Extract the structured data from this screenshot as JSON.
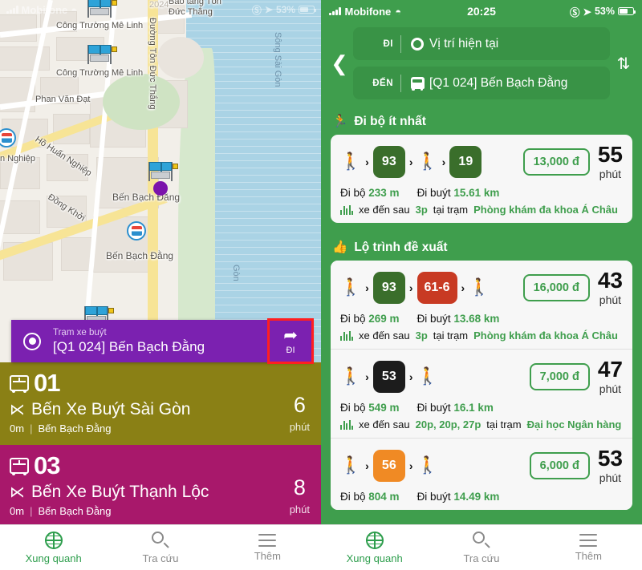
{
  "left_panel": {
    "status_bar": {
      "carrier": "Mobifone",
      "wifi_icon": "wifi-icon",
      "lock_icon": "rotation-lock-icon",
      "location_icon": "location-arrow-icon",
      "battery_text": "53%"
    },
    "map": {
      "labels": [
        "Công Trường Mê Linh",
        "Công Trường Mê Linh",
        "Bảo tàng Tôn Đức Thắng",
        "Phan Văn Đạt",
        "Hồ Huấn Nghiệp",
        "n Nghiệp",
        "Đồng Khởi",
        "Đường Tôn Đức Thắng",
        "Sông Sài Gòn",
        "Gòn",
        "Bến Bạch Đằng",
        "Bến Bạch Đằng",
        "2024"
      ]
    },
    "stop_card": {
      "kicker": "Trạm xe buýt",
      "title": "[Q1 024] Bến Bạch Đằng",
      "go_label": "ĐI",
      "go_icon": "share-arrow-icon",
      "target_icon": "crosshair-icon",
      "bg_color": "#7b21b0",
      "highlight_color": "#ff1f1f"
    },
    "routes": [
      {
        "number": "01",
        "destination": "Bến Xe Buýt Sài Gòn",
        "distance": "0m",
        "stop": "Bến Bạch Đằng",
        "minutes": "6",
        "unit": "phút",
        "color": "#8a8015"
      },
      {
        "number": "03",
        "destination": "Bến Xe Buýt Thạnh Lộc",
        "distance": "0m",
        "stop": "Bến Bạch Đằng",
        "minutes": "8",
        "unit": "phút",
        "color": "#a8186b"
      }
    ],
    "tabbar": [
      {
        "label": "Xung quanh",
        "icon": "globe-icon",
        "active": true
      },
      {
        "label": "Tra cứu",
        "icon": "search-icon",
        "active": false
      },
      {
        "label": "Thêm",
        "icon": "hamburger-icon",
        "active": false
      }
    ]
  },
  "right_panel": {
    "status_bar": {
      "carrier": "Mobifone",
      "wifi_icon": "wifi-icon",
      "time": "20:25",
      "battery_text": "53%"
    },
    "search": {
      "back_icon": "chevron-left-icon",
      "swap_icon": "swap-vertical-icon",
      "origin": {
        "kicker": "ĐI",
        "icon": "gps-icon",
        "value": "Vị trí hiện tại"
      },
      "destination": {
        "kicker": "ĐẾN",
        "icon": "bus-icon",
        "value": "[Q1 024] Bến Bạch Đằng"
      }
    },
    "sections": [
      {
        "icon": "walking-person-emoji",
        "title": "Đi bộ ít nhất",
        "options": [
          {
            "legs": [
              {
                "type": "walk"
              },
              {
                "type": "bus",
                "label": "93",
                "color": "#3a6e2b"
              },
              {
                "type": "walk"
              },
              {
                "type": "bus",
                "label": "19",
                "color": "#3a6e2b"
              }
            ],
            "fare": "13,000 đ",
            "duration": "55",
            "duration_unit": "phút",
            "walk_label": "Đi bộ",
            "walk_value": "233 m",
            "bus_label": "Đi buýt",
            "bus_value": "15.61 km",
            "arrival_prefix": "xe đến sau",
            "arrival_time": "3p",
            "arrival_mid": "tại trạm",
            "arrival_stop": "Phòng khám đa khoa Á Châu"
          }
        ]
      },
      {
        "icon": "thumbs-up-emoji",
        "title": "Lộ trình đề xuất",
        "options": [
          {
            "legs": [
              {
                "type": "walk"
              },
              {
                "type": "bus",
                "label": "93",
                "color": "#3a6e2b"
              },
              {
                "type": "bus",
                "label": "61-6",
                "color": "#c83a23"
              },
              {
                "type": "walk"
              }
            ],
            "fare": "16,000 đ",
            "duration": "43",
            "duration_unit": "phút",
            "walk_label": "Đi bộ",
            "walk_value": "269 m",
            "bus_label": "Đi buýt",
            "bus_value": "13.68 km",
            "arrival_prefix": "xe đến sau",
            "arrival_time": "3p",
            "arrival_mid": "tại trạm",
            "arrival_stop": "Phòng khám đa khoa Á Châu"
          },
          {
            "legs": [
              {
                "type": "walk"
              },
              {
                "type": "bus",
                "label": "53",
                "color": "#1c1c1c"
              },
              {
                "type": "walk"
              }
            ],
            "fare": "7,000 đ",
            "duration": "47",
            "duration_unit": "phút",
            "walk_label": "Đi bộ",
            "walk_value": "549 m",
            "bus_label": "Đi buýt",
            "bus_value": "16.1 km",
            "arrival_prefix": "xe đến sau",
            "arrival_time": "20p, 20p, 27p",
            "arrival_mid": "tại trạm",
            "arrival_stop": "Đại học Ngân hàng"
          },
          {
            "legs": [
              {
                "type": "walk"
              },
              {
                "type": "bus",
                "label": "56",
                "color": "#f08a24"
              },
              {
                "type": "walk"
              }
            ],
            "fare": "6,000 đ",
            "duration": "53",
            "duration_unit": "phút",
            "walk_label": "Đi bộ",
            "walk_value": "804 m",
            "bus_label": "Đi buýt",
            "bus_value": "14.49 km",
            "arrival_prefix": "",
            "arrival_time": "",
            "arrival_mid": "",
            "arrival_stop": ""
          }
        ]
      }
    ],
    "tabbar": [
      {
        "label": "Xung quanh",
        "icon": "globe-icon",
        "active": true
      },
      {
        "label": "Tra cứu",
        "icon": "search-icon",
        "active": false
      },
      {
        "label": "Thêm",
        "icon": "hamburger-icon",
        "active": false
      }
    ]
  }
}
